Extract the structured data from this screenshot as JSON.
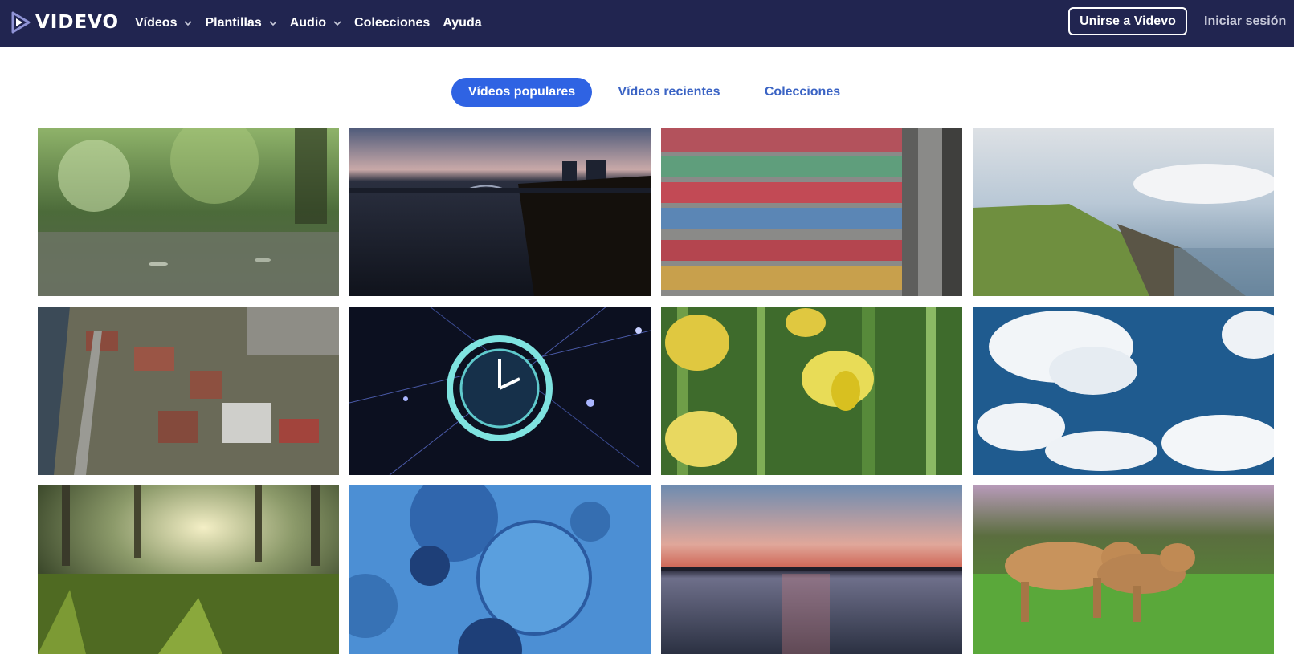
{
  "brand": {
    "name": "VIDEVO",
    "color": "#212550",
    "accent": "#2f63e3"
  },
  "nav": {
    "items": [
      {
        "label": "Vídeos",
        "has_dropdown": true,
        "icon": "chevron-down-icon"
      },
      {
        "label": "Plantillas",
        "has_dropdown": true,
        "icon": "chevron-down-icon"
      },
      {
        "label": "Audio",
        "has_dropdown": true,
        "icon": "chevron-down-icon"
      },
      {
        "label": "Colecciones",
        "has_dropdown": false
      },
      {
        "label": "Ayuda",
        "has_dropdown": false
      }
    ],
    "join_label": "Unirse a Videvo",
    "login_label": "Iniciar sesión"
  },
  "tabs": [
    {
      "label": "Vídeos populares",
      "active": true
    },
    {
      "label": "Vídeos recientes",
      "active": false
    },
    {
      "label": "Colecciones",
      "active": false
    }
  ],
  "videos": [
    {
      "subject": "rain-drops-forest"
    },
    {
      "subject": "river-city-dusk"
    },
    {
      "subject": "shipping-containers-aerial"
    },
    {
      "subject": "coastline-green-hills"
    },
    {
      "subject": "campus-aerial"
    },
    {
      "subject": "glowing-clock-network"
    },
    {
      "subject": "yellow-daffodils"
    },
    {
      "subject": "clouds-blue-sky"
    },
    {
      "subject": "sunlit-grass-forest"
    },
    {
      "subject": "blue-cells-microscope"
    },
    {
      "subject": "sunset-over-water"
    },
    {
      "subject": "lionesses-grassland"
    }
  ]
}
